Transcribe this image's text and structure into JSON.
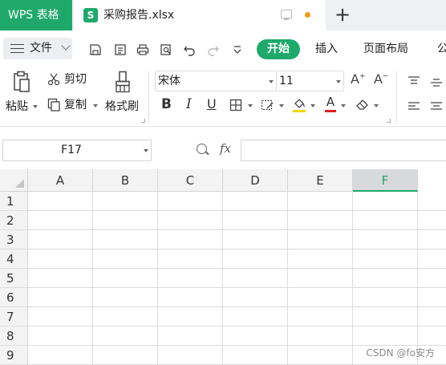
{
  "titlebar": {
    "app_tab": "WPS 表格",
    "doc_badge": "S",
    "doc_title": "采购报告.xlsx",
    "new_tab_symbol": "+"
  },
  "menubar": {
    "file_label": "文件",
    "tabs": [
      "开始",
      "插入",
      "页面布局",
      "公"
    ]
  },
  "ribbon": {
    "paste_label": "粘贴",
    "cut_label": "剪切",
    "copy_label": "复制",
    "format_painter_label": "格式刷",
    "font_name": "宋体",
    "font_size": "11",
    "bold": "B",
    "italic": "I",
    "underline": "U",
    "font_color_letter": "A",
    "grow_font": "A",
    "shrink_font": "A"
  },
  "formula_bar": {
    "cell_ref": "F17",
    "fx": "fx",
    "formula": ""
  },
  "grid": {
    "columns": [
      "A",
      "B",
      "C",
      "D",
      "E",
      "F"
    ],
    "active_column": "F",
    "rows": [
      "1",
      "2",
      "3",
      "4",
      "5",
      "6",
      "7",
      "8",
      "9"
    ]
  },
  "watermark": "CSDN @fo安方",
  "colors": {
    "accent": "#1ea96b",
    "font_color_bar": "#e02020",
    "fill_color_bar": "#f2d600"
  }
}
